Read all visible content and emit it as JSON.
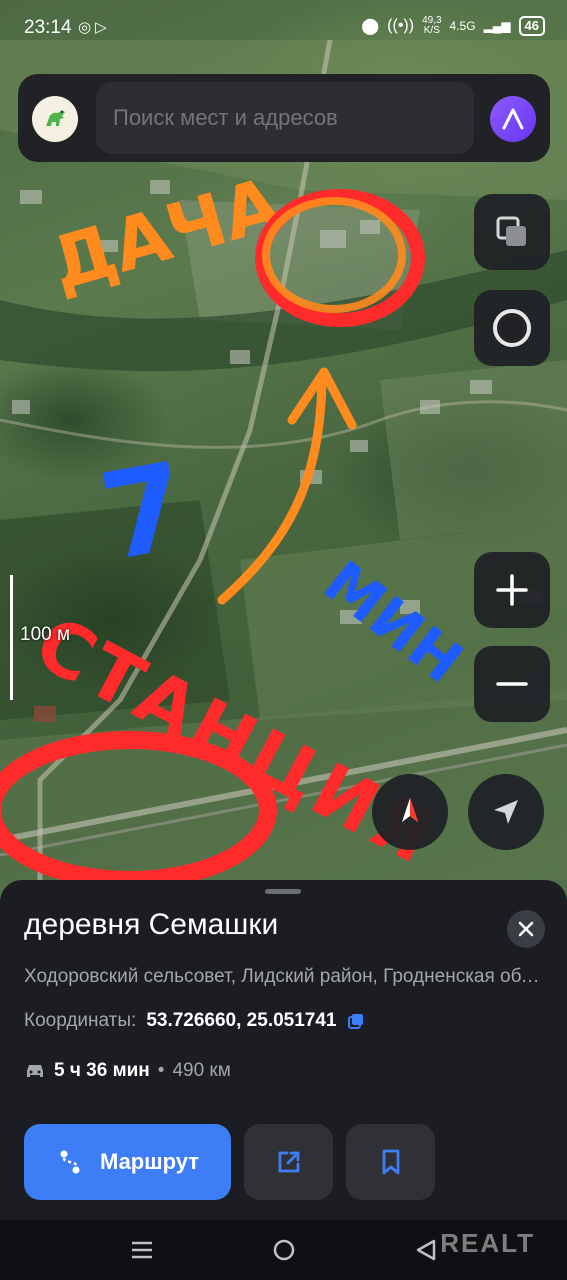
{
  "status_bar": {
    "time": "23:14",
    "left_icons": [
      "viber-icon",
      "play-icon"
    ],
    "speed_value": "49,3",
    "speed_unit": "K/S",
    "network": "4.5G",
    "battery": "46"
  },
  "search": {
    "placeholder": "Поиск мест и адресов"
  },
  "map": {
    "scale_label": "100 м",
    "annotations": {
      "dacha": "ДАЧА",
      "minutes": "7",
      "min_word": "МИН",
      "station": "СТАНЦИЯ"
    },
    "annotation_colors": {
      "orange": "#ff8a1e",
      "red": "#ff2a2a",
      "blue": "#1f5cff"
    }
  },
  "place": {
    "title": "деревня Семашки",
    "address": "Ходоровский сельсовет, Лидский район, Гродненская область",
    "coords_label": "Координаты:",
    "coords_value": "53.726660, 25.051741",
    "travel_time": "5 ч 36 мин",
    "travel_sep": "•",
    "travel_distance": "490 км"
  },
  "actions": {
    "route_label": "Маршрут"
  },
  "navbar": {
    "watermark": "REALT"
  },
  "colors": {
    "accent": "#3d7df5",
    "panel": "#202226",
    "sheet": "#1b1d22"
  }
}
